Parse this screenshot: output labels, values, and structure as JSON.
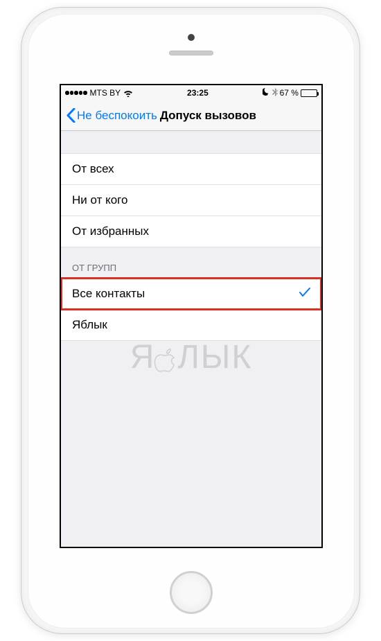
{
  "status_bar": {
    "carrier": "MTS BY",
    "time": "23:25",
    "battery_percent": "67 %"
  },
  "nav": {
    "back_label": "Не беспокоить",
    "title": "Допуск вызовов"
  },
  "sections": {
    "main": {
      "items": [
        "От всех",
        "Ни от кого",
        "От избранных"
      ]
    },
    "groups": {
      "header": "ОТ ГРУПП",
      "items": [
        "Все контакты",
        "Яблык"
      ],
      "selected_index": 0
    }
  },
  "watermark": {
    "left": "Я",
    "right": "ЛЫК"
  }
}
